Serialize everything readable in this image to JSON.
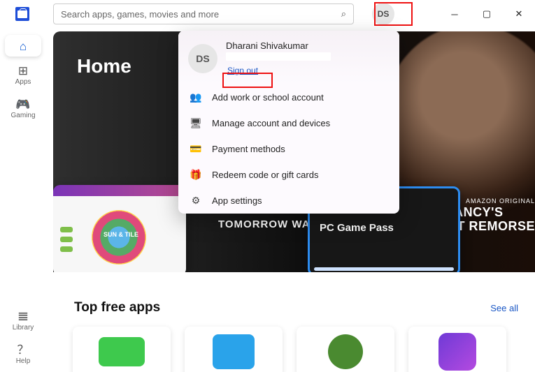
{
  "search": {
    "placeholder": "Search apps, games, movies and more"
  },
  "avatar_initials": "DS",
  "nav": {
    "home": "Home",
    "apps": "Apps",
    "gaming": "Gaming",
    "library": "Library",
    "help": "Help"
  },
  "hero": {
    "title": "Home",
    "tomorrow": "TOMORROW WAR",
    "amazon": "AMAZON ORIGINAL",
    "clancy": "TOM CLANCY'S\nWITHOUT REMORSE",
    "pass_label": "PC Game Pass",
    "thumb_text": "SUN & TILE"
  },
  "dropdown": {
    "initials": "DS",
    "name": "Dharani Shivakumar",
    "signout": "Sign out",
    "items": [
      {
        "icon": "👥",
        "label": "Add work or school account"
      },
      {
        "icon": "🖥",
        "label": "Manage account and devices"
      },
      {
        "icon": "💳",
        "label": "Payment methods"
      },
      {
        "icon": "🎁",
        "label": "Redeem code or gift cards"
      },
      {
        "icon": "⚙",
        "label": "App settings"
      }
    ]
  },
  "section": {
    "title": "Top free apps",
    "seeall": "See all"
  }
}
